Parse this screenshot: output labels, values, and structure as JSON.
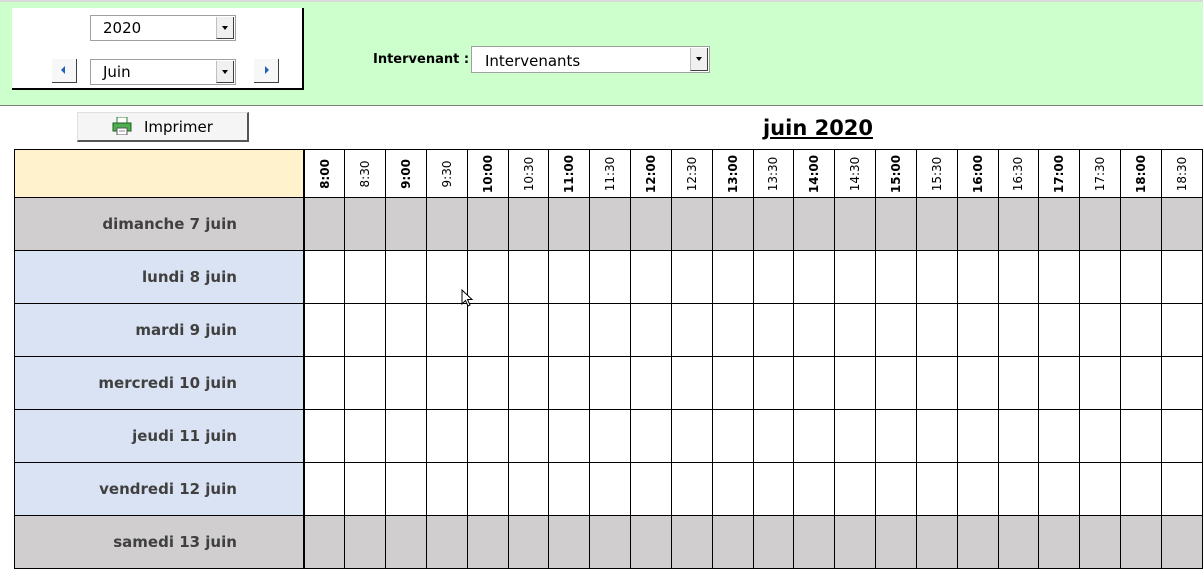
{
  "nav": {
    "year": "2020",
    "month": "Juin"
  },
  "intervenant": {
    "label": "Intervenant :",
    "value": "Intervenants"
  },
  "toolbar": {
    "print_label": "Imprimer"
  },
  "planning": {
    "title": "juin 2020",
    "times": [
      "8:00",
      "8:30",
      "9:00",
      "9:30",
      "10:00",
      "10:30",
      "11:00",
      "11:30",
      "12:00",
      "12:30",
      "13:00",
      "13:30",
      "14:00",
      "14:30",
      "15:00",
      "15:30",
      "16:00",
      "16:30",
      "17:00",
      "17:30",
      "18:00",
      "18:30"
    ],
    "days": [
      {
        "label": "dimanche 7 juin",
        "weekend": true
      },
      {
        "label": "lundi 8 juin",
        "weekend": false
      },
      {
        "label": "mardi 9 juin",
        "weekend": false
      },
      {
        "label": "mercredi 10 juin",
        "weekend": false
      },
      {
        "label": "jeudi 11 juin",
        "weekend": false
      },
      {
        "label": "vendredi 12 juin",
        "weekend": false
      },
      {
        "label": "samedi 13 juin",
        "weekend": true
      }
    ]
  },
  "colors": {
    "top_band": "#ccffcc",
    "header_corner": "#fff2cc",
    "weekday_label": "#dae3f3",
    "weekend": "#d0cece"
  },
  "icons": [
    "dropdown-arrow-icon",
    "previous-arrow-icon",
    "next-arrow-icon",
    "printer-icon",
    "mouse-pointer-icon"
  ]
}
